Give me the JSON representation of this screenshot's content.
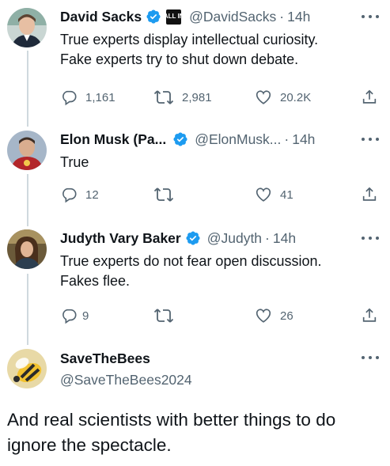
{
  "tweets": [
    {
      "name": "David Sacks",
      "badge": "ALL IN",
      "handle": "@DavidSacks",
      "time": "14h",
      "lines": [
        "True experts display intellectual curiosity.",
        "Fake experts try to shut down debate."
      ],
      "replies": "1,161",
      "retweets": "2,981",
      "likes": "20.2K"
    },
    {
      "name": "Elon Musk (Pa...",
      "handle": "@ElonMusk...",
      "time": "14h",
      "lines": [
        "True"
      ],
      "replies": "12",
      "retweets": "",
      "likes": "41"
    },
    {
      "name": "Judyth Vary Baker",
      "handle": "@Judyth",
      "time": "14h",
      "lines": [
        "True experts do not fear open discussion.",
        "Fakes flee."
      ],
      "replies": "9",
      "retweets": "",
      "likes": "26"
    }
  ],
  "reply_author": {
    "name": "SaveTheBees",
    "handle": "@SaveTheBees2024"
  },
  "reply_text": "And real scientists with better things to do ignore the spectacle.",
  "icons": {
    "verified": "verified-badge-icon",
    "reply": "reply-icon",
    "retweet": "retweet-icon",
    "like": "heart-icon",
    "share": "share-icon",
    "more": "more-icon"
  },
  "colors": {
    "verified": "#1d9bf0",
    "text": "#0f1419",
    "muted": "#536471",
    "thread_line": "#cfd9de"
  }
}
